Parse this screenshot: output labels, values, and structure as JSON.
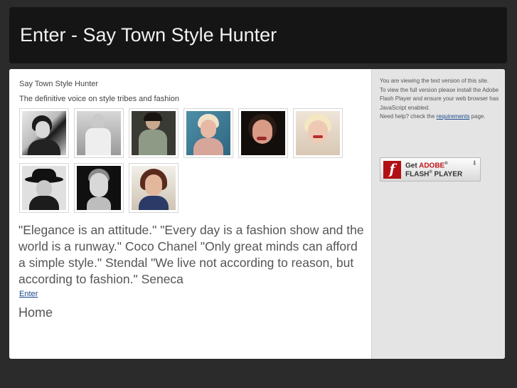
{
  "header": {
    "title": "Enter - Say Town Style Hunter"
  },
  "main": {
    "site_name": "Say Town Style Hunter",
    "tagline": "The definitive voice on style tribes and fashion",
    "quote": "\"Elegance is an attitude.\" \"Every day is a fashion show and the world is a runway.\" Coco Chanel \"Only great minds can afford a simple style.\" Stendal \"We live not according to reason, but according to fashion.\" Seneca",
    "enter_link": "Enter",
    "home": "Home"
  },
  "gallery": {
    "images": [
      {
        "name": "thumb-1"
      },
      {
        "name": "thumb-2"
      },
      {
        "name": "thumb-3"
      },
      {
        "name": "thumb-4"
      },
      {
        "name": "thumb-5"
      },
      {
        "name": "thumb-6"
      },
      {
        "name": "thumb-7"
      },
      {
        "name": "thumb-8"
      },
      {
        "name": "thumb-9"
      }
    ]
  },
  "sidebar": {
    "line1": "You are viewing the text version of this site.",
    "line2": "To view the full version please install the Adobe Flash Player and ensure your web browser has JavaScript enabled.",
    "help_prefix": "Need help? check the",
    "help_link": "requirements",
    "help_suffix": "page.",
    "flash_get": "Get",
    "flash_adobe": "ADOBE",
    "flash_player": "FLASH",
    "flash_player2": "PLAYER",
    "flash_logo": "f"
  },
  "colors": {
    "page_bg": "#2b2b2b",
    "header_bg": "#151515",
    "sidebar_bg": "#e4e4e4",
    "link": "#1a4a8a",
    "adobe_red": "#c0151b"
  }
}
